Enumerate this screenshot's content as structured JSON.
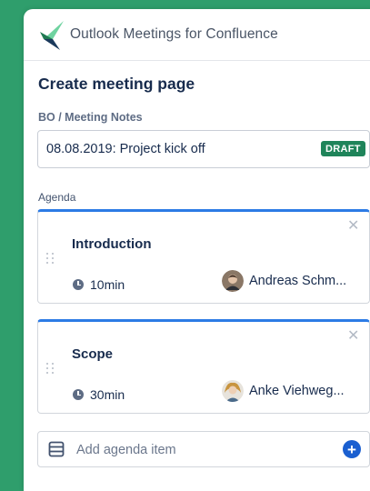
{
  "app": {
    "title": "Outlook Meetings for Confluence"
  },
  "page": {
    "heading": "Create meeting page"
  },
  "breadcrumb": "BO / Meeting Notes",
  "title_field": {
    "value": "08.08.2019: Project kick off",
    "status_badge": "DRAFT"
  },
  "agenda": {
    "label": "Agenda",
    "items": [
      {
        "title": "Introduction",
        "duration": "10min",
        "presenter": "Andreas Schm...",
        "icon": "clock-icon"
      },
      {
        "title": "Scope",
        "duration": "30min",
        "presenter": "Anke Viehweg...",
        "icon": "clock-icon"
      }
    ],
    "add_label": "Add agenda item"
  },
  "colors": {
    "background": "#2f9e6c",
    "accent": "#2c7be5",
    "draft": "#1f845a",
    "add_button": "#1a5fd0"
  }
}
